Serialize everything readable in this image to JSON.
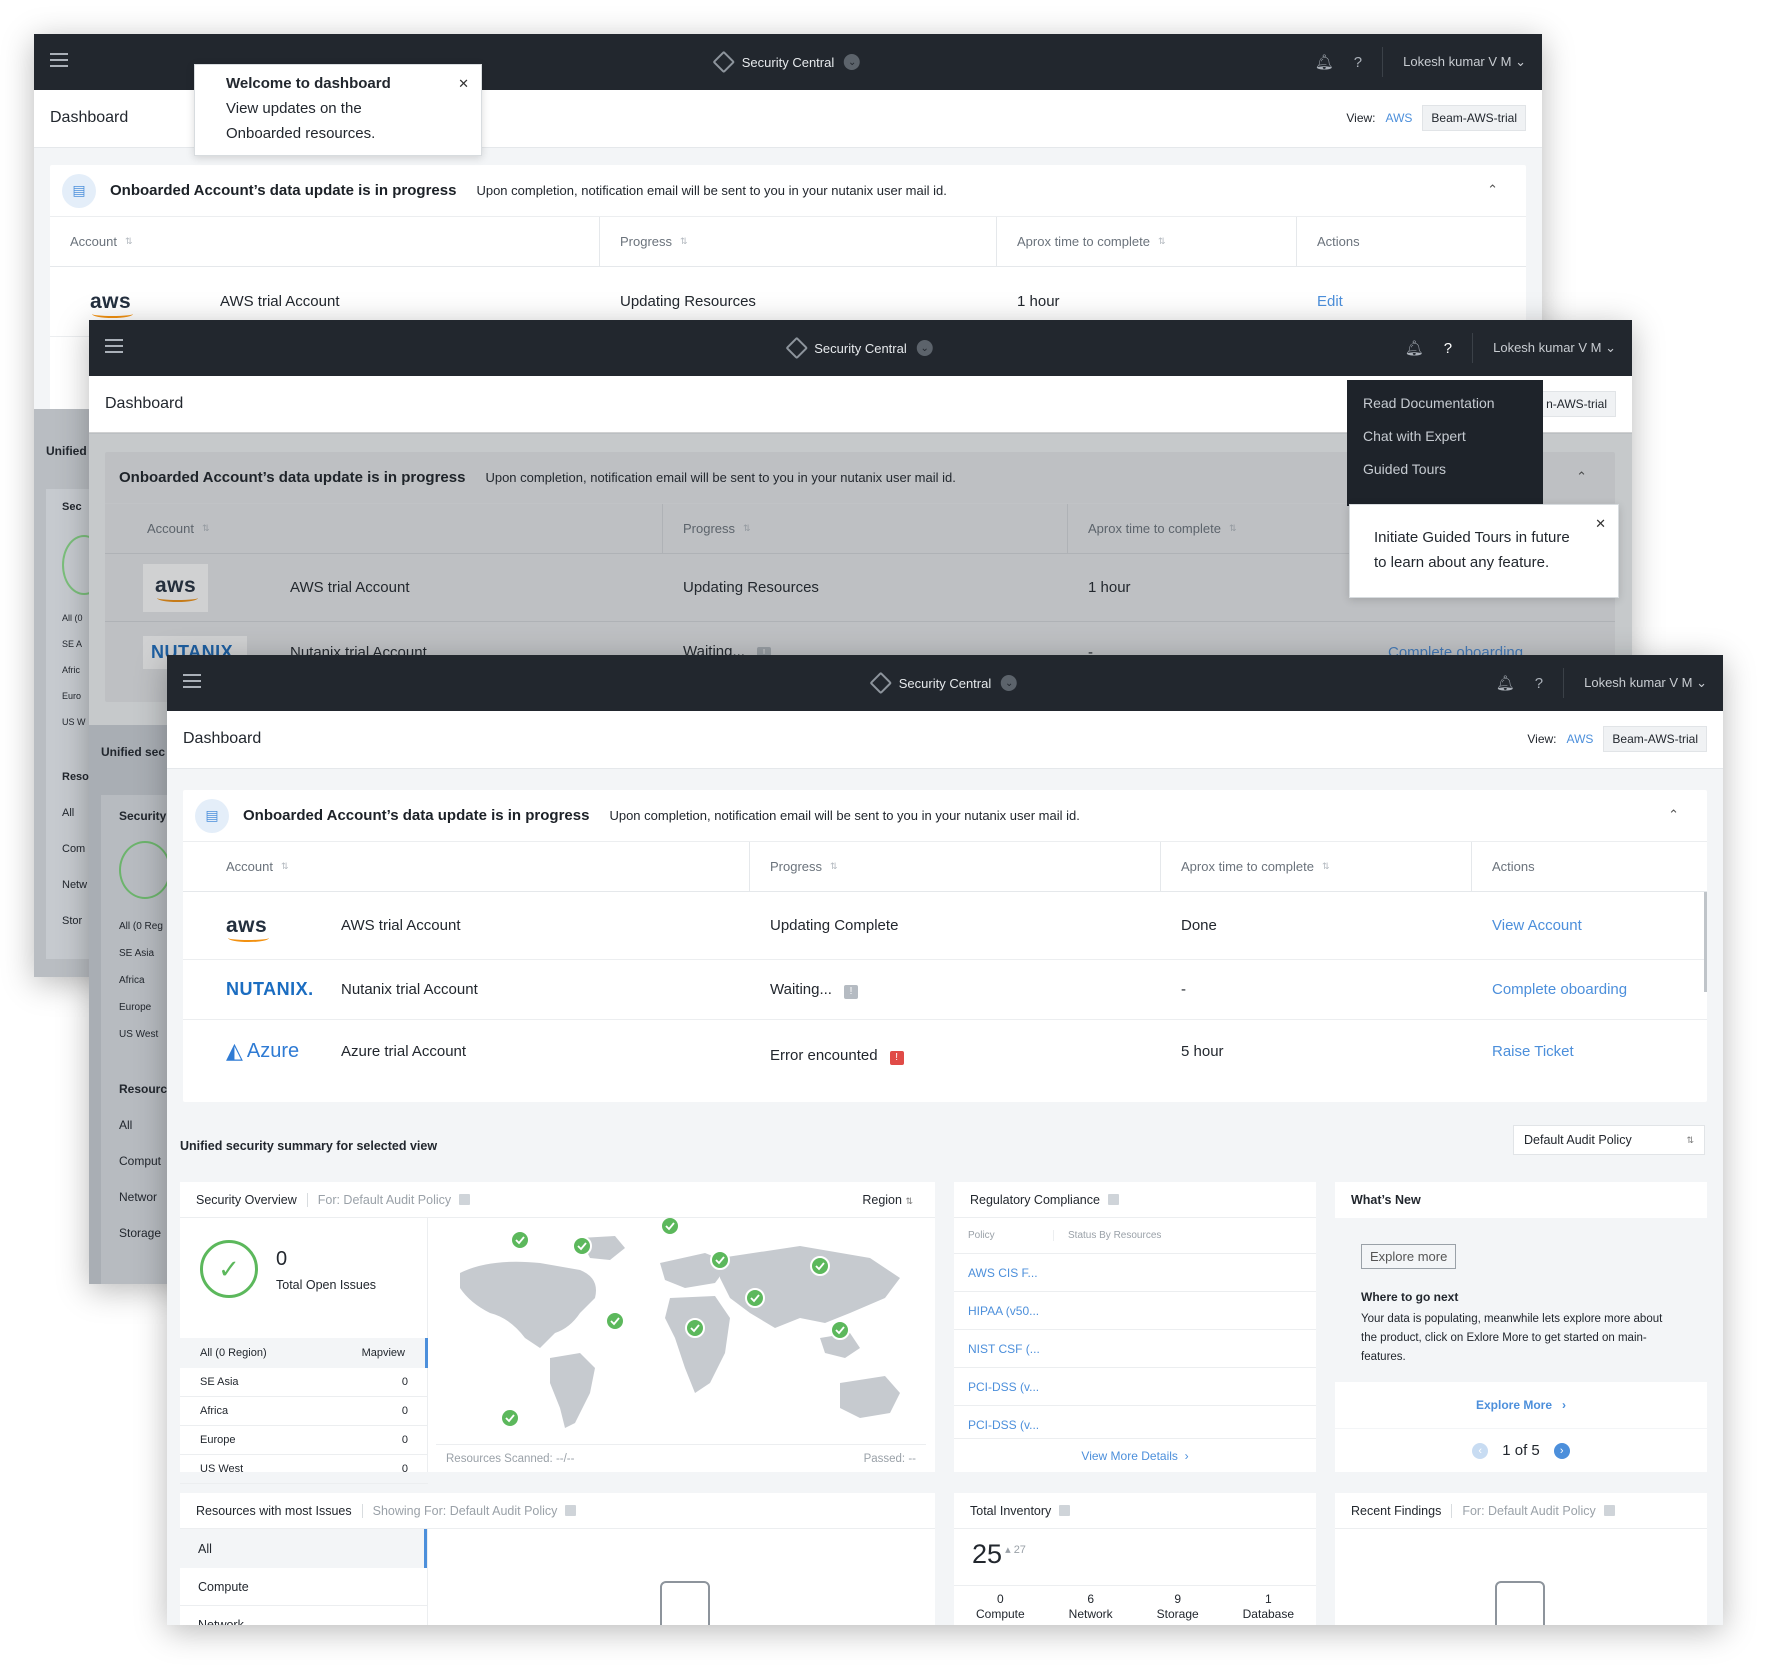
{
  "app": {
    "name": "Security Central",
    "page_title": "Dashboard",
    "user": "Lokesh kumar V M",
    "view_label": "View:",
    "view_cloud": "AWS",
    "view_account": "Beam-AWS-trial",
    "view_account_clipped": "n-AWS-trial"
  },
  "onboarding": {
    "title": "Onboarded Account’s data update is in progress",
    "note": "Upon completion, notification email will be sent to you in your nutanix user mail id.",
    "columns": [
      "Account",
      "Progress",
      "Aprox time to complete",
      "Actions"
    ]
  },
  "win1": {
    "tooltip_title": "Welcome to dashboard",
    "tooltip_line1": "View updates on the",
    "tooltip_line2": "Onboarded resources.",
    "rows": [
      {
        "logo": "aws",
        "account": "AWS trial Account",
        "progress": "Updating Resources",
        "time": "1 hour",
        "action": "Edit"
      }
    ],
    "side_labels": [
      "Unified",
      "Sec",
      "All (0",
      "SE A",
      "Afric",
      "Euro",
      "US W",
      "Reso",
      "All",
      "Com",
      "Netw",
      "Stor"
    ]
  },
  "win2": {
    "help_menu": [
      "Read Documentation",
      "Chat with Expert",
      "Guided Tours"
    ],
    "tooltip_line1": "Initiate Guided Tours in future",
    "tooltip_line2": "to learn about any feature.",
    "rows": [
      {
        "logo": "aws",
        "account": "AWS trial Account",
        "progress": "Updating Resources",
        "time": "1 hour",
        "action": ""
      },
      {
        "logo": "NUTANIX.",
        "account": "Nutanix trial Account",
        "progress": "Waiting...",
        "time": "-",
        "action": "Complete oboarding"
      }
    ],
    "side_labels": [
      "Unified sec",
      "Security",
      "All (0 Reg",
      "SE Asia",
      "Africa",
      "Europe",
      "US West",
      "Resourc",
      "All",
      "Comput",
      "Networ",
      "Storage"
    ]
  },
  "win3": {
    "rows": [
      {
        "logo": "aws",
        "account": "AWS trial Account",
        "progress": "Updating Complete",
        "status": "",
        "time": "Done",
        "action": "View Account"
      },
      {
        "logo": "NUTANIX.",
        "account": "Nutanix trial Account",
        "progress": "Waiting...",
        "status": "waiting",
        "time": "-",
        "action": "Complete oboarding"
      },
      {
        "logo": "Azure",
        "account": "Azure trial Account",
        "progress": "Error encounted",
        "status": "error",
        "time": "5 hour",
        "action": "Raise Ticket"
      }
    ],
    "summary_title": "Unified security summary for selected view",
    "policy_select": "Default Audit Policy",
    "security_overview": {
      "title": "Security Overview",
      "for": "For: Default Audit Policy",
      "region_select": "Region",
      "issues_count": "0",
      "issues_label": "Total Open Issues",
      "region_header": "All (0 Region)",
      "mapview": "Mapview",
      "regions": [
        {
          "name": "SE Asia",
          "count": "0"
        },
        {
          "name": "Africa",
          "count": "0"
        },
        {
          "name": "Europe",
          "count": "0"
        },
        {
          "name": "US West",
          "count": "0"
        }
      ],
      "resources_scanned": "Resources Scanned: --/--",
      "passed": "Passed: --"
    },
    "compliance": {
      "title": "Regulatory Compliance",
      "col_policy": "Policy",
      "col_status": "Status By Resources",
      "policies": [
        "AWS CIS F...",
        "HIPAA (v50...",
        "NIST CSF (...",
        "PCI-DSS (v...",
        "PCI-DSS (v..."
      ],
      "more": "View More Details"
    },
    "whats_new": {
      "title": "What’s New",
      "explore_btn": "Explore more",
      "heading": "Where to go next",
      "body": "Your data is populating, meanwhile lets explore more about the product, click on Exlore More to get started on main-features.",
      "explore_link": "Explore More",
      "pager": "1 of 5"
    },
    "resources": {
      "title": "Resources with most Issues",
      "for": "Showing For: Default Audit Policy",
      "tabs": [
        "All",
        "Compute",
        "Network"
      ]
    },
    "inventory": {
      "title": "Total Inventory",
      "total": "25",
      "delta": "27",
      "items": [
        {
          "count": "0",
          "label": "Compute"
        },
        {
          "count": "6",
          "label": "Network"
        },
        {
          "count": "9",
          "label": "Storage"
        },
        {
          "count": "1",
          "label": "Database"
        }
      ]
    },
    "findings": {
      "title": "Recent Findings",
      "for": "For: Default Audit Policy"
    }
  },
  "colors": {
    "topbar": "#22272e",
    "accent": "#4c8fdb",
    "success": "#5cb85c",
    "error": "#e04b47"
  }
}
